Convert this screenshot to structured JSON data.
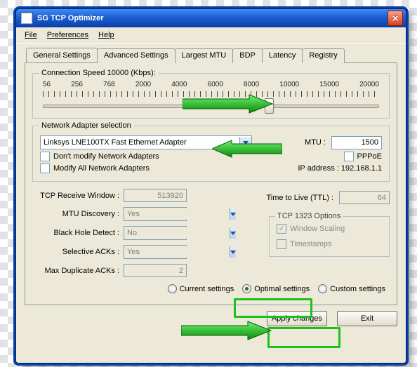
{
  "title": "SG TCP Optimizer",
  "menu": {
    "file": "File",
    "prefs": "Preferences",
    "help": "Help"
  },
  "tabs": {
    "general": "General Settings",
    "advanced": "Advanced Settings",
    "mtu": "Largest MTU",
    "bdp": "BDP",
    "latency": "Latency",
    "registry": "Registry"
  },
  "speed": {
    "legend": "Connection Speed  10000 (Kbps):",
    "labels": [
      "56",
      "256",
      "768",
      "2000",
      "4000",
      "6000",
      "8000",
      "10000",
      "15000",
      "20000"
    ],
    "thumb_pct": 66
  },
  "adapter": {
    "legend": "Network Adapter selection",
    "selected": "Linksys LNE100TX Fast Ethernet Adapter",
    "mtu_label": "MTU :",
    "mtu": "1500",
    "dont_modify": "Don't modify Network Adapters",
    "modify_all": "Modify All Network Adapters",
    "pppoe": "PPPoE",
    "ip_label": "IP address : 192.168.1.1"
  },
  "fields": {
    "recv_label": "TCP Receive Window :",
    "recv": "513920",
    "mtud_label": "MTU Discovery :",
    "mtud": "Yes",
    "bhd_label": "Black Hole Detect :",
    "bhd": "No",
    "sack_label": "Selective ACKs :",
    "sack": "Yes",
    "mdack_label": "Max Duplicate ACKs :",
    "mdack": "2",
    "ttl_label": "Time to Live (TTL) :",
    "ttl": "64"
  },
  "tcp1323": {
    "legend": "TCP 1323 Options",
    "ws": "Window Scaling",
    "ts": "Timestamps"
  },
  "settings": {
    "current": "Current settings",
    "optimal": "Optimal settings",
    "custom": "Custom settings"
  },
  "buttons": {
    "apply": "Apply changes",
    "exit": "Exit"
  }
}
